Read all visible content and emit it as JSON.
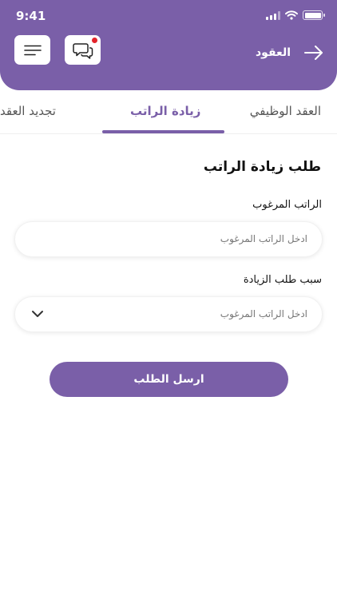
{
  "status_bar": {
    "time": "9:41"
  },
  "header": {
    "title": "العقود",
    "back_icon": "arrow-right-icon",
    "chat_icon": "chat-bubbles-icon",
    "menu_icon": "hamburger-menu-icon",
    "accent_color": "#7a5fa8",
    "notification_color": "#e3242b"
  },
  "tabs": [
    {
      "label": "العقد الوظيفي",
      "active": false
    },
    {
      "label": "زيادة الراتب",
      "active": true
    },
    {
      "label": "تجديد العقد",
      "active": false
    }
  ],
  "form": {
    "title": "طلب زيادة الراتب",
    "salary_label": "الراتب المرغوب",
    "salary_placeholder": "ادخل الراتب المرغوب",
    "reason_label": "سبب طلب الزيادة",
    "reason_selected": "ادخل الراتب المرغوب",
    "submit_label": "ارسل الطلب"
  }
}
